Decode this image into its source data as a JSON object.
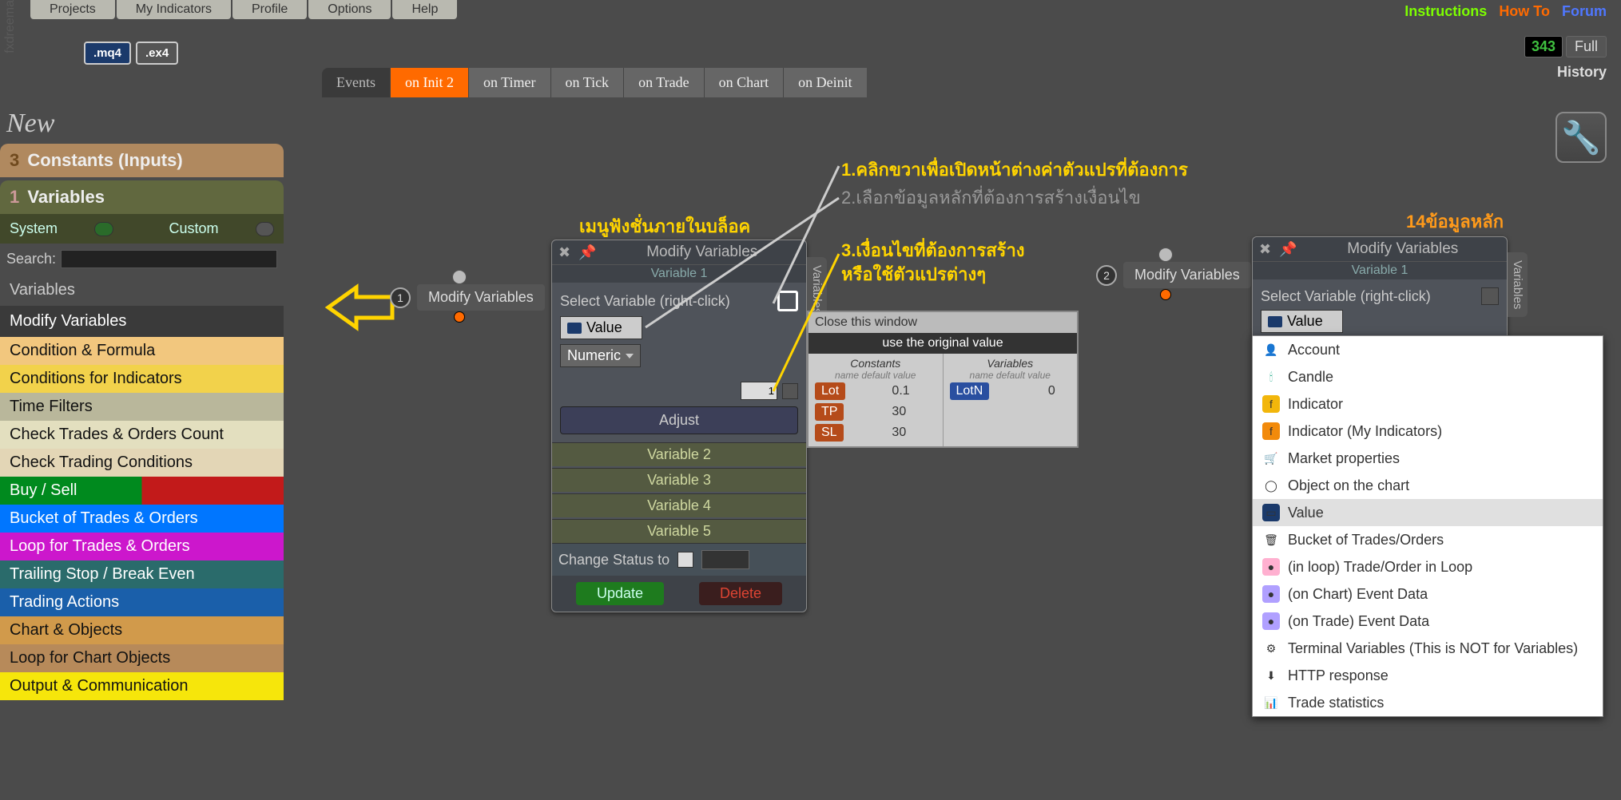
{
  "watermark": "fxdreema",
  "topMenu": [
    "Projects",
    "My Indicators",
    "Profile",
    "Options",
    "Help"
  ],
  "topRight": {
    "instructions": "Instructions",
    "howto": "How To",
    "forum": "Forum"
  },
  "counter": {
    "num": "343",
    "mode": "Full",
    "history": "History"
  },
  "fileBadges": {
    "mq4": ".mq4",
    "ex4": ".ex4"
  },
  "eventTabs": {
    "label": "Events",
    "items": [
      "on Init",
      "on Timer",
      "on Tick",
      "on Trade",
      "on Chart",
      "on Deinit"
    ],
    "activeIndex": 0,
    "activeBadgeSuffix": "2"
  },
  "brandNew": "New",
  "sidebar": {
    "constants": {
      "num": "3",
      "label": "Constants (Inputs)"
    },
    "variables": {
      "num": "1",
      "label": "Variables"
    },
    "system": "System",
    "custom": "Custom",
    "searchLabel": "Search:",
    "headingVariables": "Variables",
    "modifyVariables": "Modify Variables",
    "categories": [
      {
        "label": "Condition & Formula",
        "bg": "#f2c77e"
      },
      {
        "label": "Conditions for Indicators",
        "bg": "#f2d24b"
      },
      {
        "label": "Time Filters",
        "bg": "#b9b79b"
      },
      {
        "label": "Check Trades & Orders Count",
        "bg": "#e3dfbf"
      },
      {
        "label": "Check Trading Conditions",
        "bg": "#e3d6b6"
      },
      {
        "label": "Buy / Sell",
        "bg": "#008a1e",
        "half2": "#c21a1a",
        "color": "#fff"
      },
      {
        "label": "Bucket of Trades & Orders",
        "bg": "#0076ff",
        "color": "#fff"
      },
      {
        "label": "Loop for Trades & Orders",
        "bg": "#cc17cc",
        "color": "#fff"
      },
      {
        "label": "Trailing Stop / Break Even",
        "bg": "#2a6b6b",
        "color": "#fff"
      },
      {
        "label": "Trading Actions",
        "bg": "#1a5faa",
        "color": "#fff"
      },
      {
        "label": "Chart & Objects",
        "bg": "#d19a4b"
      },
      {
        "label": "Loop for Chart Objects",
        "bg": "#b78a5a"
      },
      {
        "label": "Output & Communication",
        "bg": "#f6e60b"
      }
    ]
  },
  "annotations": {
    "menuTitle": "เมนูฟังชั่นภายในบล็อค",
    "a1": "1.คลิกขวาเพื่อเปิดหน้าต่างค่าตัวแปรที่ต้องการ",
    "a2": "2.เลือกข้อมูลหลักที่ต้องการสร้างเงื่อนไข",
    "a3_l1": "3.เงื่อนไขที่ต้องการสร้าง",
    "a3_l2": "หรือใช้ตัวแปรต่างๆ",
    "right": "14ข้อมูลหลัก"
  },
  "node1": {
    "idx": "1",
    "label": "Modify Variables"
  },
  "node2": {
    "idx": "2",
    "label": "Modify Variables"
  },
  "panel": {
    "title": "Modify Variables",
    "variable1": "Variable 1",
    "selectVar": "Select Variable (right-click)",
    "valueLabel": "Value",
    "numericLabel": "Numeric",
    "numVal": "1",
    "adjust": "Adjust",
    "rows": [
      "Variable 2",
      "Variable 3",
      "Variable 4",
      "Variable 5"
    ],
    "changeStatus": "Change Status to",
    "update": "Update",
    "delete": "Delete"
  },
  "popup": {
    "close": "Close this window",
    "orig": "use the original value",
    "constantsHdr": "Constants",
    "subhdr": "name   default value",
    "variablesHdr": "Variables",
    "constants": [
      {
        "name": "Lot",
        "val": "0.1"
      },
      {
        "name": "TP",
        "val": "30"
      },
      {
        "name": "SL",
        "val": "30"
      }
    ],
    "vars": [
      {
        "name": "LotN",
        "val": "0"
      }
    ]
  },
  "panel2": {
    "title": "Modify Variables",
    "variable1": "Variable 1",
    "selectVar": "Select Variable (right-click)",
    "valueLabel": "Value"
  },
  "contextMenu": [
    {
      "icon": "👤",
      "bg": "#fff",
      "label": "Account"
    },
    {
      "icon": "🕯",
      "bg": "#fff",
      "label": "Candle",
      "color": "#2a8"
    },
    {
      "icon": "f",
      "bg": "#f2b60b",
      "label": "Indicator"
    },
    {
      "icon": "f",
      "bg": "#f28a0b",
      "label": "Indicator (My Indicators)"
    },
    {
      "icon": "🛒",
      "bg": "#fff",
      "label": "Market properties"
    },
    {
      "icon": "◯",
      "bg": "#fff",
      "label": "Object on the chart"
    },
    {
      "icon": "▭",
      "bg": "#1b3a6b",
      "label": "Value",
      "sel": true
    },
    {
      "icon": "🗑",
      "bg": "#fff",
      "label": "Bucket of Trades/Orders"
    },
    {
      "icon": "●",
      "bg": "#ffb0d0",
      "label": "(in loop) Trade/Order in Loop"
    },
    {
      "icon": "●",
      "bg": "#b0a0ff",
      "label": "(on Chart) Event Data"
    },
    {
      "icon": "●",
      "bg": "#b0a0ff",
      "label": "(on Trade) Event Data"
    },
    {
      "icon": "⚙",
      "bg": "#fff",
      "label": "Terminal Variables (This is NOT for Variables)"
    },
    {
      "icon": "⬇",
      "bg": "#fff",
      "label": "HTTP response"
    },
    {
      "icon": "📊",
      "bg": "#fff",
      "label": "Trade statistics"
    }
  ],
  "vtab": "Variables"
}
